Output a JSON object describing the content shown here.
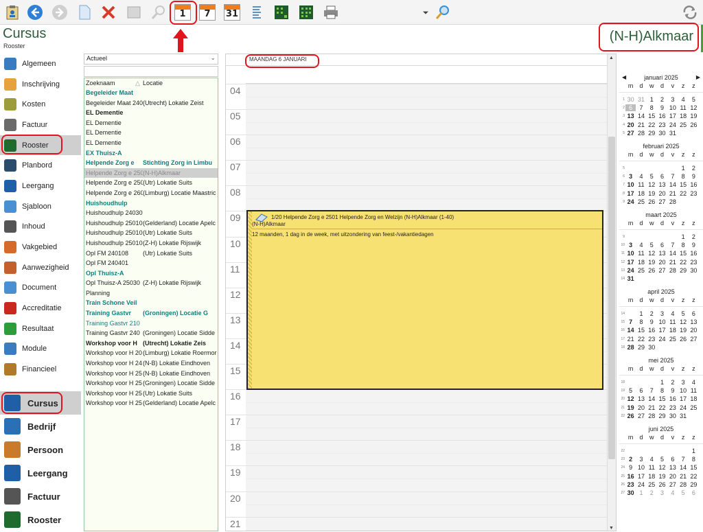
{
  "toolbar": {
    "buttons": [
      "clipboard",
      "back",
      "forward",
      "new-document",
      "delete",
      "image",
      "search",
      "day-view",
      "week-view",
      "month-view",
      "list-view",
      "grid-add",
      "grid-view",
      "print",
      "zoom",
      "refresh"
    ],
    "day_num": "1",
    "week_num": "7",
    "month_num": "31"
  },
  "header": {
    "title": "Cursus",
    "subtitle": "Rooster",
    "location": "(N-H)Alkmaar"
  },
  "nav": {
    "items": [
      {
        "label": "Algemeen",
        "color": "#3b7bbf"
      },
      {
        "label": "Inschrijving",
        "color": "#e6a23c"
      },
      {
        "label": "Kosten",
        "color": "#9c9c3c"
      },
      {
        "label": "Factuur",
        "color": "#6b6b6b"
      },
      {
        "label": "Rooster",
        "color": "#1f6b2e",
        "active": true
      },
      {
        "label": "Planbord",
        "color": "#2b4d6b"
      },
      {
        "label": "Leergang",
        "color": "#1f5fa8"
      },
      {
        "label": "Sjabloon",
        "color": "#4a8fd1"
      },
      {
        "label": "Inhoud",
        "color": "#555555"
      },
      {
        "label": "Vakgebied",
        "color": "#d46a2b"
      },
      {
        "label": "Aanwezigheid",
        "color": "#c4602c"
      },
      {
        "label": "Document",
        "color": "#4a8fd1"
      },
      {
        "label": "Accreditatie",
        "color": "#c8281e"
      },
      {
        "label": "Resultaat",
        "color": "#2e9c3a"
      },
      {
        "label": "Module",
        "color": "#3b7bbf"
      },
      {
        "label": "Financieel",
        "color": "#b07a2a"
      }
    ]
  },
  "modules": [
    {
      "label": "Cursus",
      "color": "#1f5fa8",
      "active": true
    },
    {
      "label": "Bedrijf",
      "color": "#2b6fb5"
    },
    {
      "label": "Persoon",
      "color": "#c97a2a"
    },
    {
      "label": "Leergang",
      "color": "#1f5fa8"
    },
    {
      "label": "Factuur",
      "color": "#555555"
    },
    {
      "label": "Rooster",
      "color": "#1f6b2e"
    }
  ],
  "list_panel": {
    "filter": "Actueel",
    "search_value": "",
    "col_name": "Zoeknaam",
    "col_location": "Locatie",
    "rows": [
      {
        "name": "Begeleider Maat",
        "loc": "",
        "style": "group"
      },
      {
        "name": "Begeleider Maat 240",
        "loc": "(Utrecht) Lokatie Zeist",
        "style": ""
      },
      {
        "name": "EL Dementie",
        "loc": "",
        "style": "bold"
      },
      {
        "name": "EL Dementie",
        "loc": "",
        "style": ""
      },
      {
        "name": "EL Dementie",
        "loc": "",
        "style": ""
      },
      {
        "name": "EL Dementie",
        "loc": "",
        "style": ""
      },
      {
        "name": "EX Thuisz-A",
        "loc": "",
        "style": "group"
      },
      {
        "name": "Helpende Zorg e",
        "loc": "Stichting Zorg in Limbu",
        "style": "group"
      },
      {
        "name": "Helpende Zorg e 250",
        "loc": "(N-H)Alkmaar",
        "style": "sel"
      },
      {
        "name": "Helpende Zorg e 250",
        "loc": "(Utr) Lokatie Suits",
        "style": ""
      },
      {
        "name": "Helpende Zorg e 260",
        "loc": "(Limburg) Locatie Maastric",
        "style": ""
      },
      {
        "name": "Huishoudhulp",
        "loc": "",
        "style": "group"
      },
      {
        "name": "Huishoudhulp 24030",
        "loc": "",
        "style": ""
      },
      {
        "name": "Huishoudhulp 25010",
        "loc": "(Gelderland) Locatie Apelc",
        "style": ""
      },
      {
        "name": "Huishoudhulp 25010",
        "loc": "(Utr) Lokatie Suits",
        "style": ""
      },
      {
        "name": "Huishoudhulp 25010",
        "loc": "(Z-H) Lokatie Rijswijk",
        "style": ""
      },
      {
        "name": "Opl FM 240108",
        "loc": "(Utr) Lokatie Suits",
        "style": ""
      },
      {
        "name": "Opl FM 240401",
        "loc": "",
        "style": ""
      },
      {
        "name": "Opl Thuisz-A",
        "loc": "",
        "style": "group"
      },
      {
        "name": "Opl Thuisz-A 25030",
        "loc": "(Z-H) Lokatie Rijswijk",
        "style": ""
      },
      {
        "name": "Planning",
        "loc": "",
        "style": ""
      },
      {
        "name": "Train Schone Veil",
        "loc": "",
        "style": "group"
      },
      {
        "name": "Training Gastvr",
        "loc": "(Groningen) Locatie G",
        "style": "group"
      },
      {
        "name": "Training Gastvr 210",
        "loc": "",
        "style": "teal"
      },
      {
        "name": "Training Gastvr 240",
        "loc": "(Groningen) Locatie Sidde",
        "style": ""
      },
      {
        "name": "Workshop voor H",
        "loc": "(Utrecht) Lokatie Zeis",
        "style": "bold"
      },
      {
        "name": "Workshop voor H 20",
        "loc": "(Limburg) Lokatie Roermor",
        "style": ""
      },
      {
        "name": "Workshop voor H 24",
        "loc": "(N-B) Lokatie Eindhoven",
        "style": ""
      },
      {
        "name": "Workshop voor H 25",
        "loc": "(N-B) Lokatie Eindhoven",
        "style": ""
      },
      {
        "name": "Workshop voor H 25",
        "loc": "(Groningen) Locatie Sidde",
        "style": ""
      },
      {
        "name": "Workshop voor H 25",
        "loc": "(Utr) Lokatie Suits",
        "style": ""
      },
      {
        "name": "Workshop voor H 25",
        "loc": "(Gelderland) Locatie Apelc",
        "style": ""
      }
    ]
  },
  "calendar": {
    "day_label": "MAANDAG 6 JANUARI",
    "hours": [
      "04",
      "05",
      "06",
      "07",
      "08",
      "09",
      "10",
      "11",
      "12",
      "13",
      "14",
      "15",
      "16",
      "17",
      "18",
      "19",
      "20",
      "21"
    ],
    "event": {
      "title": "1/20 Helpende Zorg e 2501 Helpende Zorg en Welzijn (N-H)Alkmaar (1-40)",
      "location": "(N-H)Alkmaar",
      "description": "12 maanden, 1 dag in de week, met uitzondering van feest-/vakantiedagen"
    }
  },
  "mini_calendar": {
    "weekdays": [
      "m",
      "d",
      "w",
      "d",
      "v",
      "z",
      "z"
    ],
    "months": [
      {
        "title": "januari 2025",
        "nav": true,
        "weeks": [
          {
            "wk": "1",
            "days": [
              "30",
              "31",
              "1",
              "2",
              "3",
              "4",
              "5"
            ],
            "other": [
              0,
              1
            ],
            "bold": []
          },
          {
            "wk": "2",
            "days": [
              "6",
              "7",
              "8",
              "9",
              "10",
              "11",
              "12"
            ],
            "today": 0,
            "bold": []
          },
          {
            "wk": "3",
            "days": [
              "13",
              "14",
              "15",
              "16",
              "17",
              "18",
              "19"
            ],
            "bold": [
              0
            ]
          },
          {
            "wk": "4",
            "days": [
              "20",
              "21",
              "22",
              "23",
              "24",
              "25",
              "26"
            ],
            "bold": [
              0
            ]
          },
          {
            "wk": "5",
            "days": [
              "27",
              "28",
              "29",
              "30",
              "31",
              "",
              ""
            ],
            "bold": [
              0
            ]
          }
        ]
      },
      {
        "title": "februari 2025",
        "weeks": [
          {
            "wk": "5",
            "days": [
              "",
              "",
              "",
              "",
              "",
              "1",
              "2"
            ],
            "bold": []
          },
          {
            "wk": "6",
            "days": [
              "3",
              "4",
              "5",
              "6",
              "7",
              "8",
              "9"
            ],
            "bold": [
              0
            ]
          },
          {
            "wk": "7",
            "days": [
              "10",
              "11",
              "12",
              "13",
              "14",
              "15",
              "16"
            ],
            "bold": [
              0
            ]
          },
          {
            "wk": "8",
            "days": [
              "17",
              "18",
              "19",
              "20",
              "21",
              "22",
              "23"
            ],
            "bold": [
              0
            ]
          },
          {
            "wk": "9",
            "days": [
              "24",
              "25",
              "26",
              "27",
              "28",
              "",
              ""
            ],
            "bold": [
              0
            ]
          }
        ]
      },
      {
        "title": "maart 2025",
        "weeks": [
          {
            "wk": "9",
            "days": [
              "",
              "",
              "",
              "",
              "",
              "1",
              "2"
            ],
            "bold": []
          },
          {
            "wk": "10",
            "days": [
              "3",
              "4",
              "5",
              "6",
              "7",
              "8",
              "9"
            ],
            "bold": [
              0
            ]
          },
          {
            "wk": "11",
            "days": [
              "10",
              "11",
              "12",
              "13",
              "14",
              "15",
              "16"
            ],
            "bold": [
              0
            ]
          },
          {
            "wk": "12",
            "days": [
              "17",
              "18",
              "19",
              "20",
              "21",
              "22",
              "23"
            ],
            "bold": [
              0
            ]
          },
          {
            "wk": "13",
            "days": [
              "24",
              "25",
              "26",
              "27",
              "28",
              "29",
              "30"
            ],
            "bold": [
              0
            ]
          },
          {
            "wk": "14",
            "days": [
              "31",
              "",
              "",
              "",
              "",
              "",
              ""
            ],
            "bold": [
              0
            ]
          }
        ]
      },
      {
        "title": "april 2025",
        "weeks": [
          {
            "wk": "14",
            "days": [
              "",
              "1",
              "2",
              "3",
              "4",
              "5",
              "6"
            ],
            "bold": []
          },
          {
            "wk": "15",
            "days": [
              "7",
              "8",
              "9",
              "10",
              "11",
              "12",
              "13"
            ],
            "bold": [
              0
            ]
          },
          {
            "wk": "16",
            "days": [
              "14",
              "15",
              "16",
              "17",
              "18",
              "19",
              "20"
            ],
            "bold": [
              0
            ]
          },
          {
            "wk": "17",
            "days": [
              "21",
              "22",
              "23",
              "24",
              "25",
              "26",
              "27"
            ],
            "bold": []
          },
          {
            "wk": "18",
            "days": [
              "28",
              "29",
              "30",
              "",
              "",
              "",
              ""
            ],
            "bold": [
              0
            ]
          }
        ]
      },
      {
        "title": "mei 2025",
        "weeks": [
          {
            "wk": "18",
            "days": [
              "",
              "",
              "",
              "1",
              "2",
              "3",
              "4"
            ],
            "bold": []
          },
          {
            "wk": "19",
            "days": [
              "5",
              "6",
              "7",
              "8",
              "9",
              "10",
              "11"
            ],
            "bold": []
          },
          {
            "wk": "20",
            "days": [
              "12",
              "13",
              "14",
              "15",
              "16",
              "17",
              "18"
            ],
            "bold": [
              0
            ]
          },
          {
            "wk": "21",
            "days": [
              "19",
              "20",
              "21",
              "22",
              "23",
              "24",
              "25"
            ],
            "bold": [
              0
            ]
          },
          {
            "wk": "22",
            "days": [
              "26",
              "27",
              "28",
              "29",
              "30",
              "31",
              ""
            ],
            "bold": [
              0
            ]
          }
        ]
      },
      {
        "title": "juni 2025",
        "weeks": [
          {
            "wk": "22",
            "days": [
              "",
              "",
              "",
              "",
              "",
              "",
              "1"
            ],
            "bold": []
          },
          {
            "wk": "23",
            "days": [
              "2",
              "3",
              "4",
              "5",
              "6",
              "7",
              "8"
            ],
            "bold": [
              0
            ]
          },
          {
            "wk": "24",
            "days": [
              "9",
              "10",
              "11",
              "12",
              "13",
              "14",
              "15"
            ],
            "bold": []
          },
          {
            "wk": "25",
            "days": [
              "16",
              "17",
              "18",
              "19",
              "20",
              "21",
              "22"
            ],
            "bold": [
              0
            ]
          },
          {
            "wk": "26",
            "days": [
              "23",
              "24",
              "25",
              "26",
              "27",
              "28",
              "29"
            ],
            "bold": [
              0
            ]
          },
          {
            "wk": "27",
            "days": [
              "30",
              "1",
              "2",
              "3",
              "4",
              "5",
              "6"
            ],
            "other": [
              1,
              2,
              3,
              4,
              5,
              6
            ],
            "bold": [
              0
            ]
          }
        ]
      }
    ]
  }
}
